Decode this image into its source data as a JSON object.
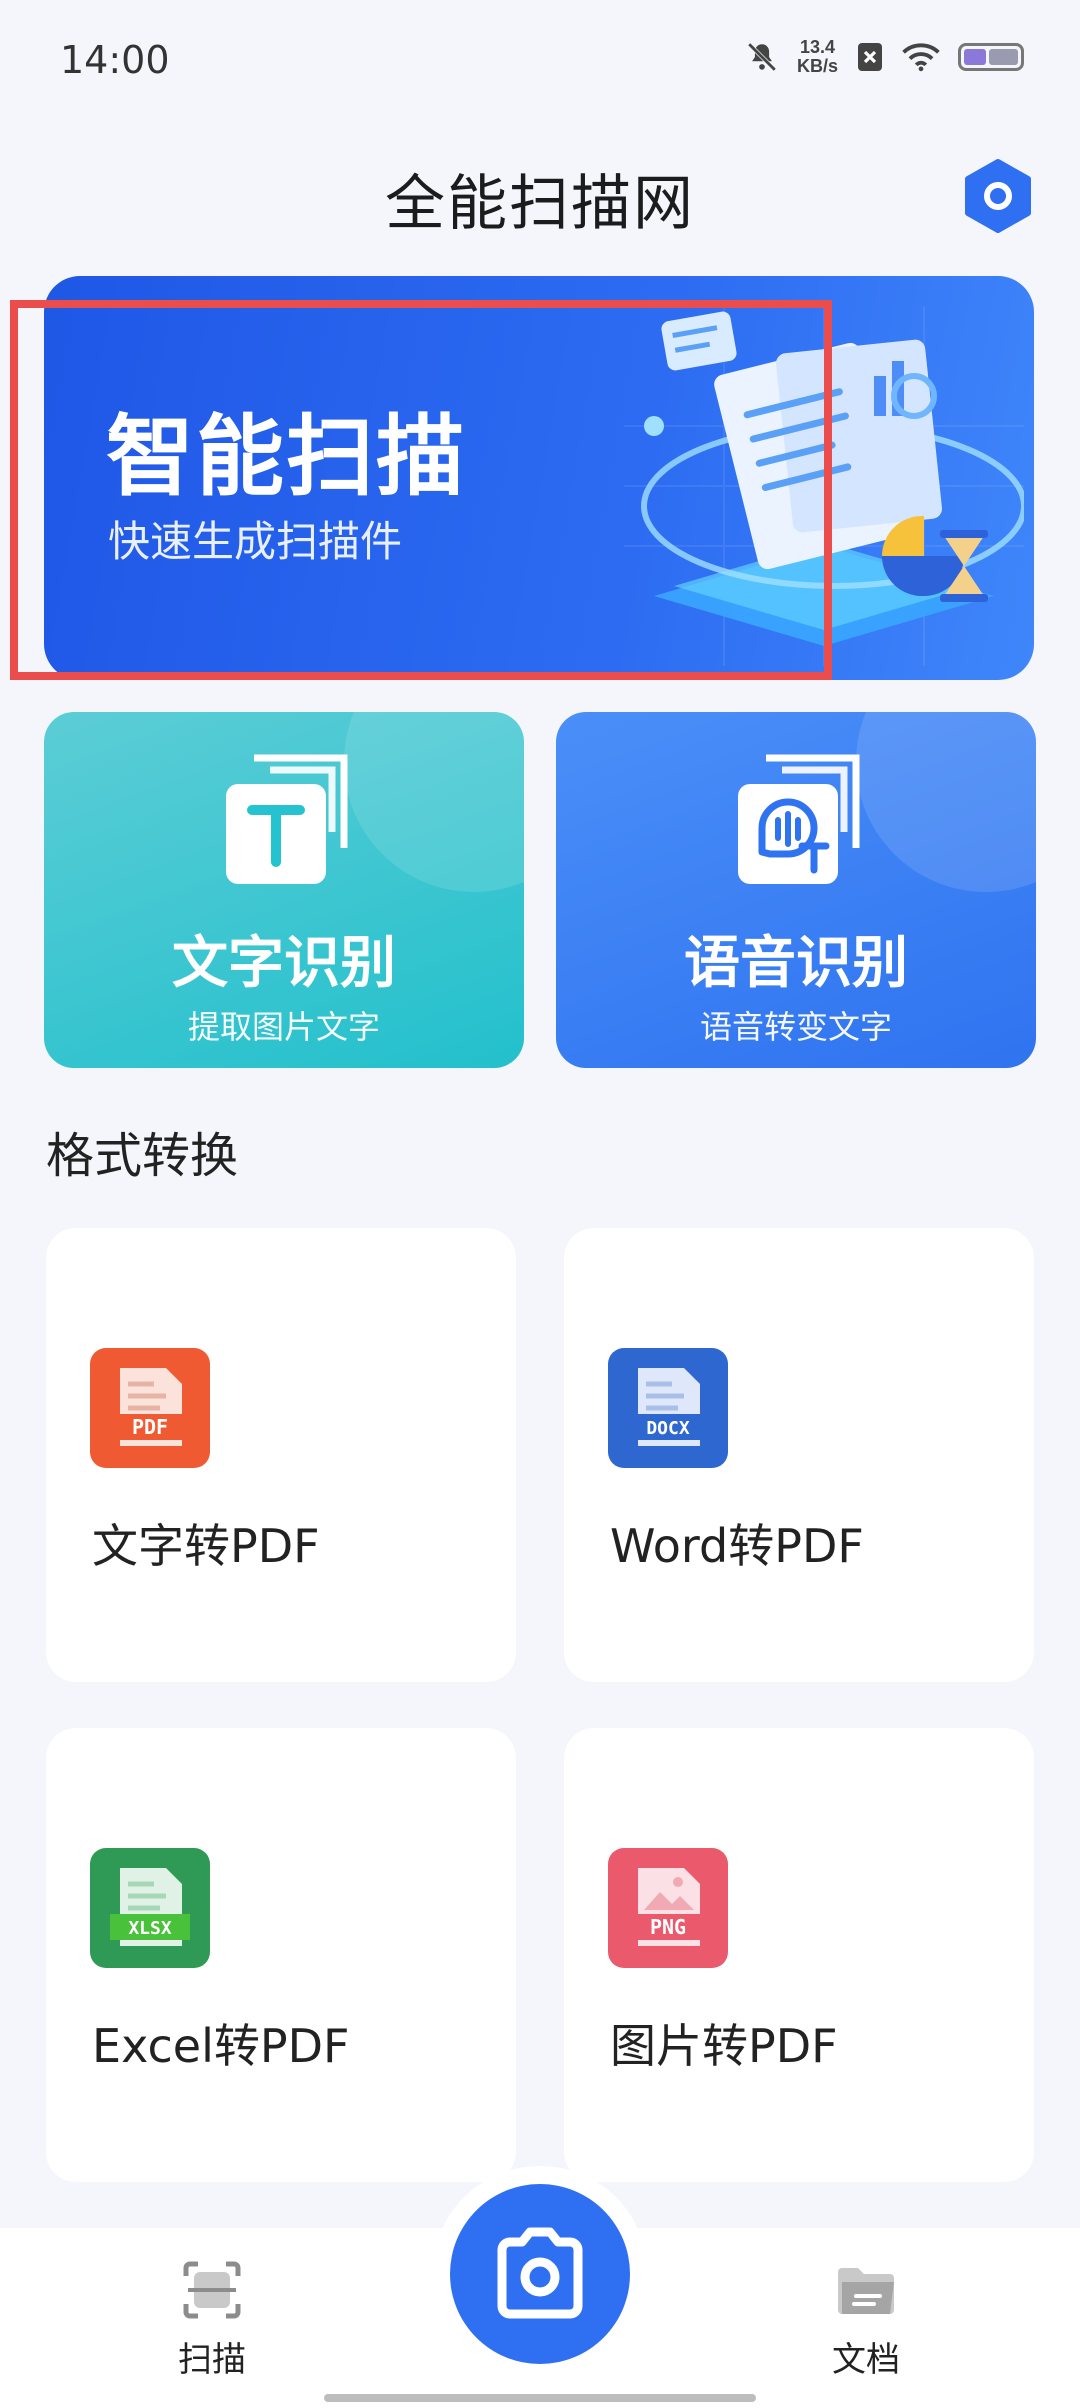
{
  "status_bar": {
    "time": "14:00",
    "speed_value": "13.4",
    "speed_unit": "KB/s",
    "battery_level": 0.3
  },
  "header": {
    "title": "全能扫描网",
    "settings_icon": "settings-hexagon-icon"
  },
  "hero": {
    "title": "智能扫描",
    "subtitle": "快速生成扫描件",
    "accent_color": "#2d6cf2"
  },
  "features": [
    {
      "title": "文字识别",
      "subtitle": "提取图片文字",
      "icon": "text-recognition-icon",
      "color": "#22c0cc"
    },
    {
      "title": "语音识别",
      "subtitle": "语音转变文字",
      "icon": "voice-recognition-icon",
      "color": "#2f73f0"
    }
  ],
  "section_title": "格式转换",
  "convert": [
    {
      "label": "文字转PDF",
      "badge": "PDF",
      "icon": "pdf-file-icon",
      "color": "#ef5a33"
    },
    {
      "label": "Word转PDF",
      "badge": "DOCX",
      "icon": "docx-file-icon",
      "color": "#2e67cf"
    },
    {
      "label": "Excel转PDF",
      "badge": "XLSX",
      "icon": "xlsx-file-icon",
      "color": "#2f9a55"
    },
    {
      "label": "图片转PDF",
      "badge": "PNG",
      "icon": "png-file-icon",
      "color": "#ea5a6c"
    }
  ],
  "nav": {
    "scan_label": "扫描",
    "docs_label": "文档",
    "camera_icon": "camera-icon"
  }
}
